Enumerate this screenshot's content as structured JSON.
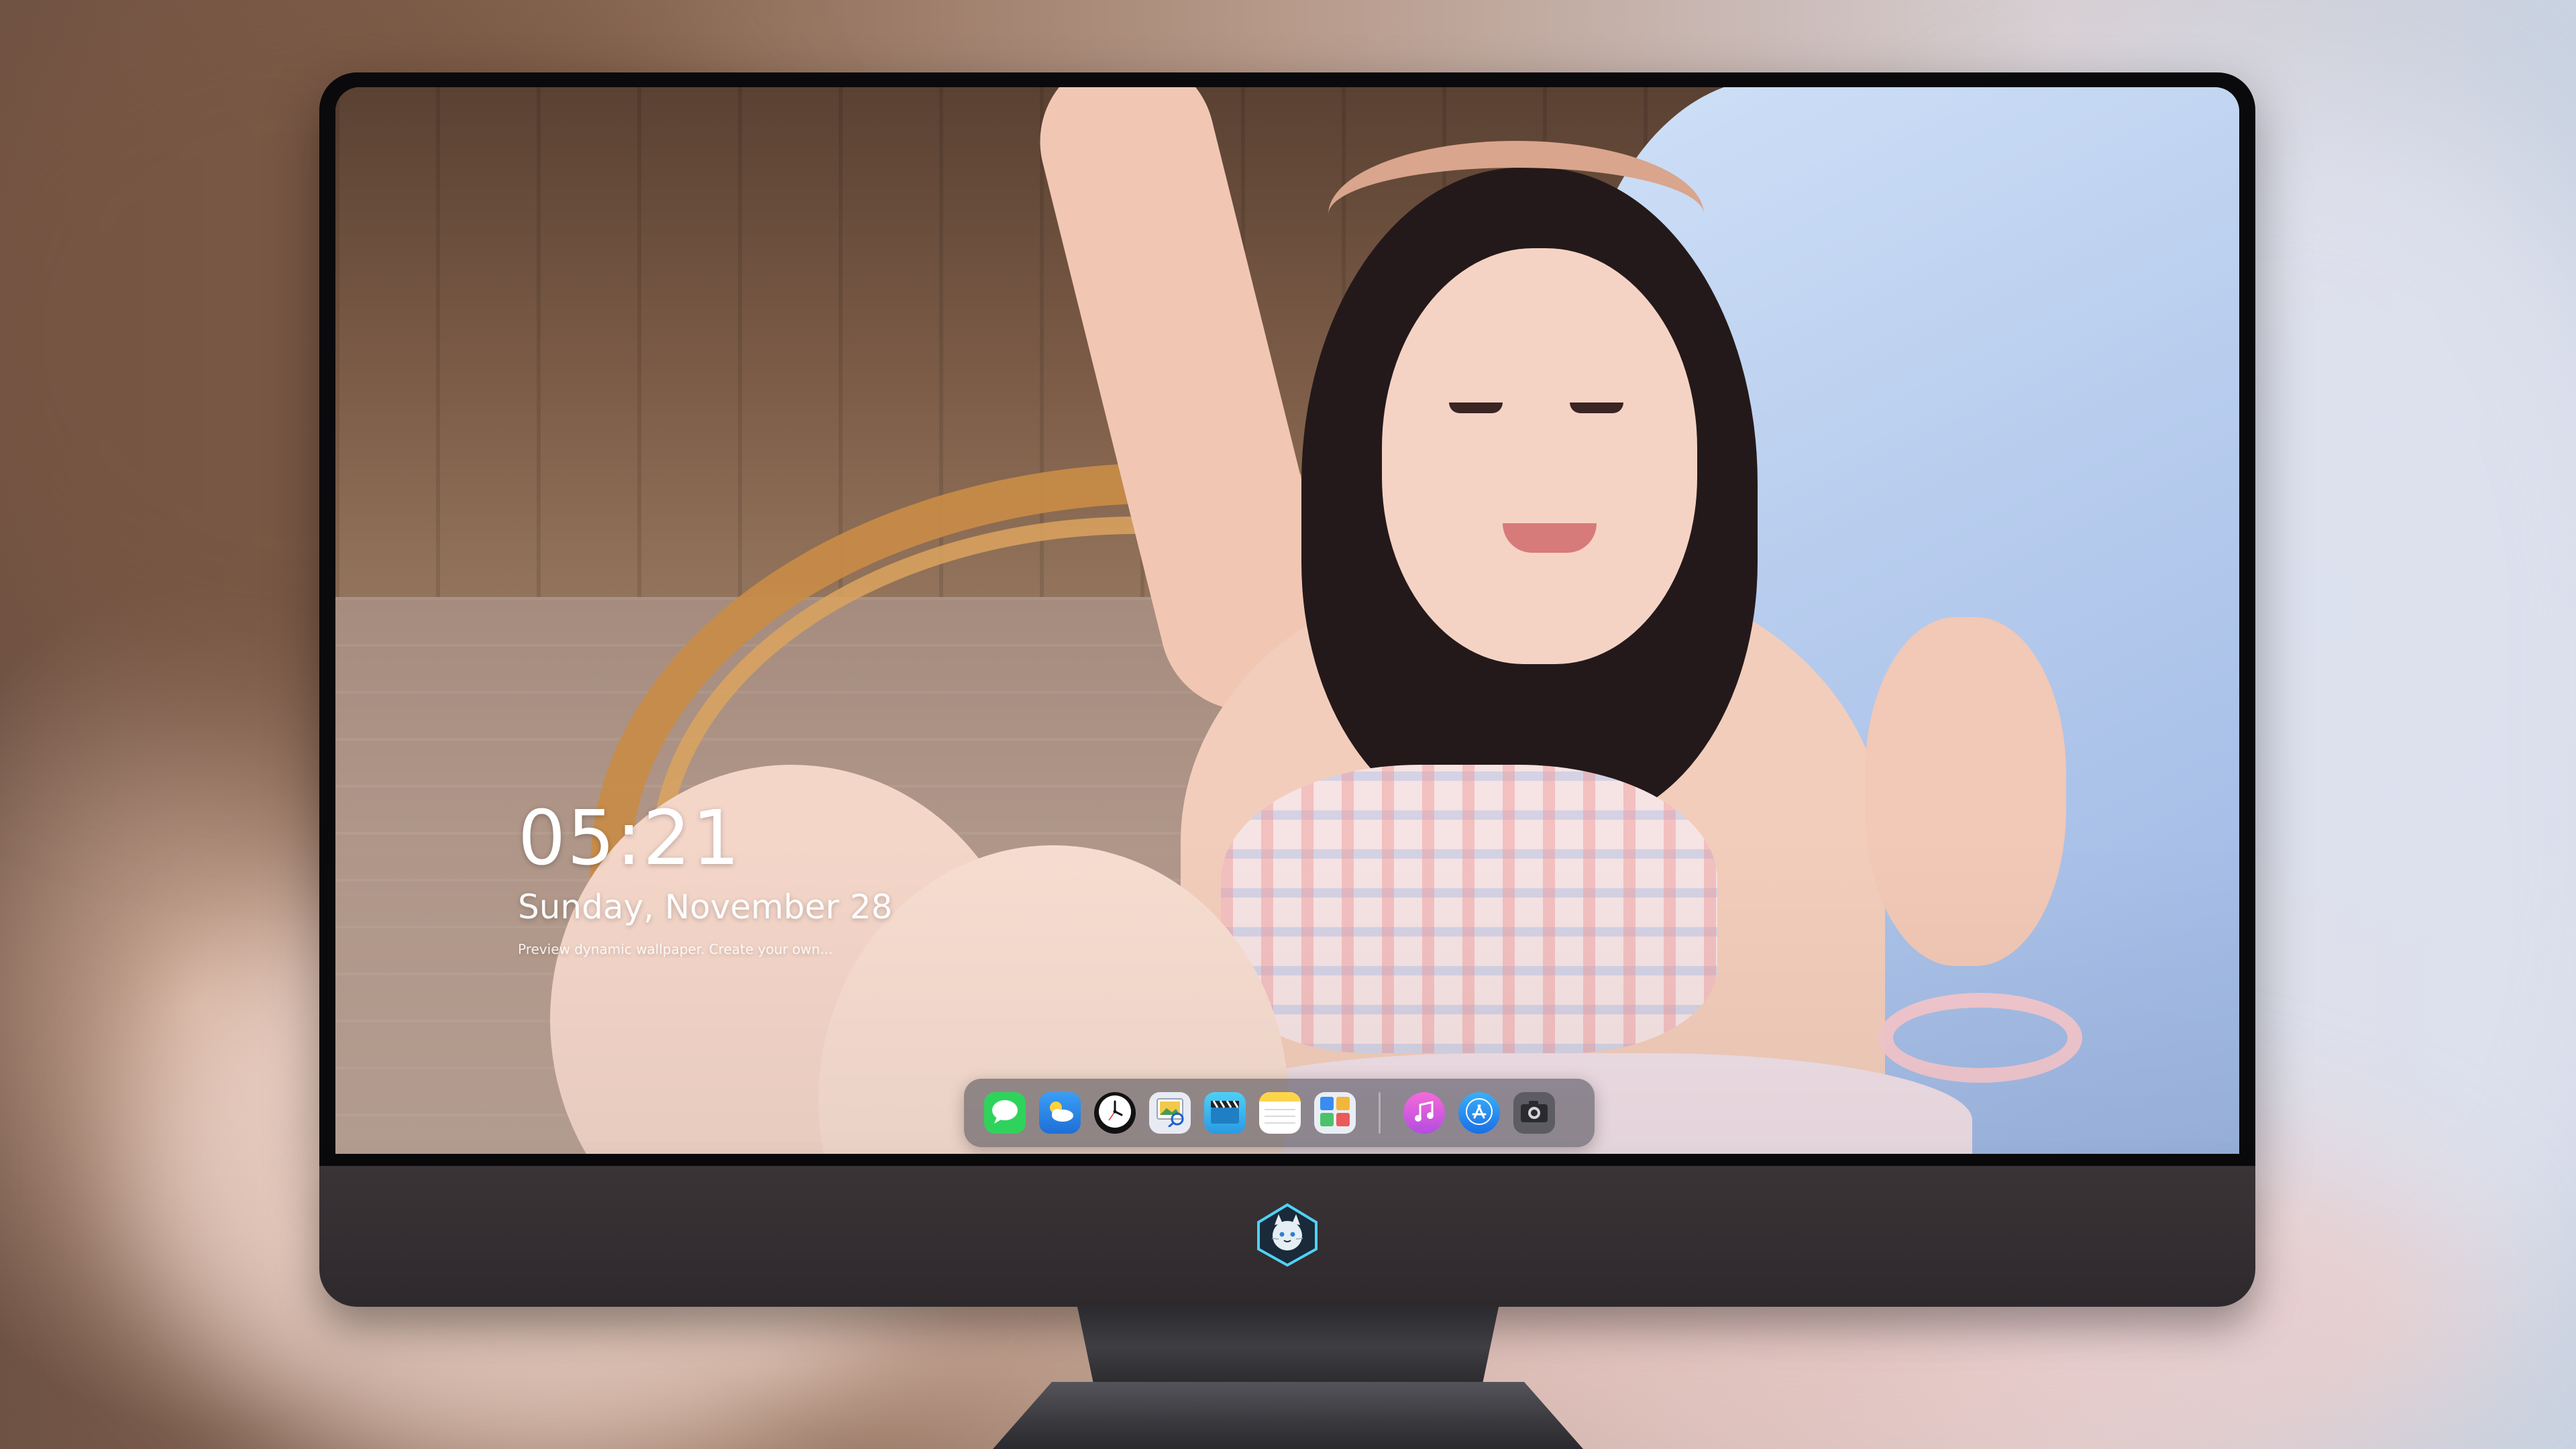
{
  "lockscreen": {
    "time": "05:21",
    "date": "Sunday, November 28",
    "hint": "Preview dynamic wallpaper. Create your own..."
  },
  "dock": {
    "apps": [
      {
        "name": "Messages",
        "icon": "messages-icon",
        "color": "#2fd35b"
      },
      {
        "name": "Weather",
        "icon": "weather-icon",
        "color": "#2a8cf0"
      },
      {
        "name": "Clock",
        "icon": "clock-icon",
        "color": "#111111"
      },
      {
        "name": "Preview",
        "icon": "preview-icon",
        "color": "#e8ebf3"
      },
      {
        "name": "Clips",
        "icon": "clips-icon",
        "color": "#35b8f0"
      },
      {
        "name": "Notes",
        "icon": "notes-icon",
        "color": "#fde27a"
      },
      {
        "name": "Widgets",
        "icon": "widgets-icon",
        "color": "#e9eef5"
      },
      {
        "name": "Music",
        "icon": "music-icon",
        "color": "#e25ad7"
      },
      {
        "name": "App Store",
        "icon": "app-store-icon",
        "color": "#1d8cf2"
      },
      {
        "name": "Camera",
        "icon": "camera-icon",
        "color": "#5c5c62"
      }
    ]
  },
  "monitor": {
    "logo": "cat-mascot-logo-icon"
  },
  "colors": {
    "bezel": "#0a0a0c",
    "chin": "#3a3437",
    "dock_bg": "rgba(70,70,80,0.55)"
  }
}
